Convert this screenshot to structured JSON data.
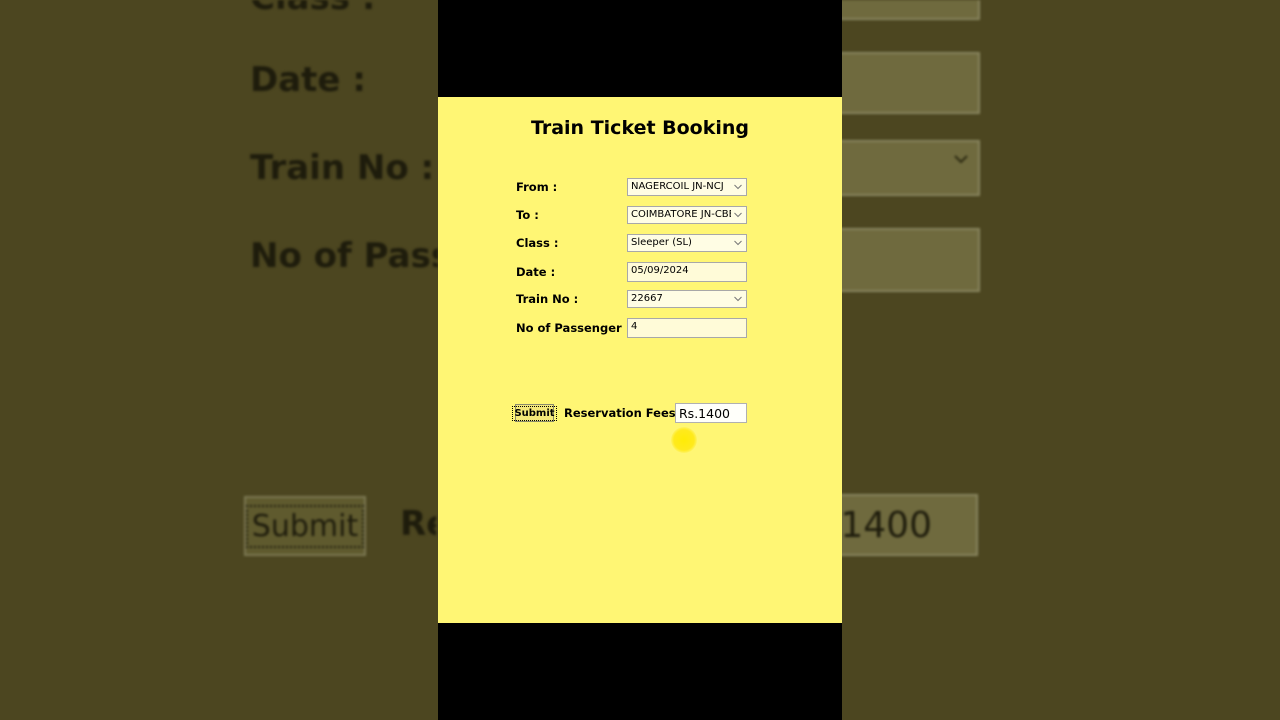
{
  "app": {
    "title": "Train Ticket Booking"
  },
  "form": {
    "from": {
      "label": "From :",
      "value": "NAGERCOIL JN-NCJ"
    },
    "to": {
      "label": "To :",
      "value": "COIMBATORE JN-CBE"
    },
    "class": {
      "label": "Class :",
      "value": "Sleeper (SL)"
    },
    "date": {
      "label": "Date :",
      "value": "05/09/2024"
    },
    "train_no": {
      "label": "Train No :",
      "value": "22667"
    },
    "passengers": {
      "label": "No of Passenger :",
      "value": "4"
    }
  },
  "actions": {
    "submit_label": "Submit",
    "fee_label": "Reservation Fees :",
    "fee_value": "Rs.1400"
  },
  "background": {
    "class_label": "Class :",
    "date_label": "Date :",
    "train_label": "Train No :",
    "passenger_label": "No of Pass",
    "submit_label": "Submit",
    "fee_label": "Re",
    "fee_value": "1400"
  },
  "colors": {
    "form_background": "#fff674",
    "outer_background": "#4c4620",
    "frame": "#000000",
    "cursor_highlight": "#ffe600"
  }
}
